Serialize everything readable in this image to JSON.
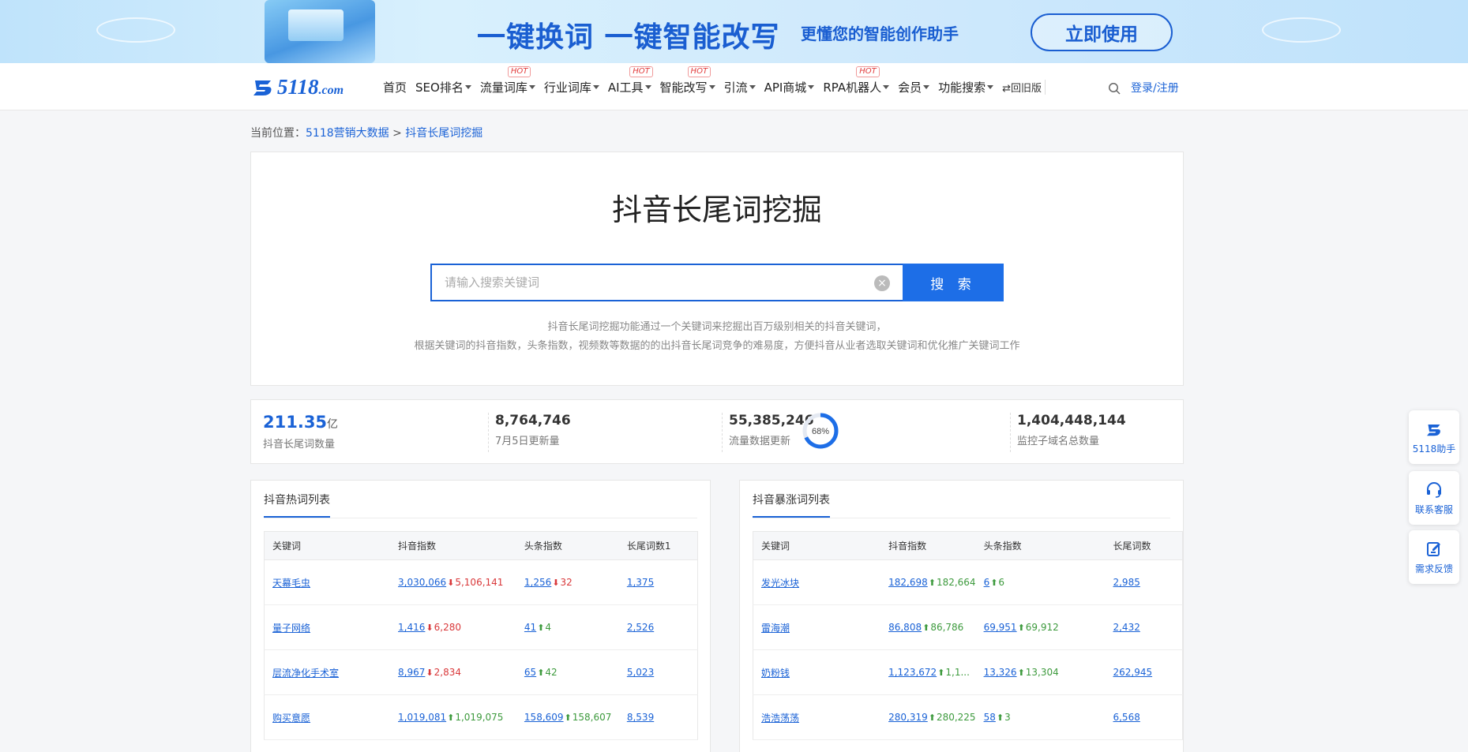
{
  "banner": {
    "slogan": "一键换词 一键智能改写",
    "sub": "更懂您的智能创作助手",
    "cta": "立即使用"
  },
  "nav": {
    "logo_main": "5118",
    "logo_suffix": ".com",
    "items": [
      {
        "label": "首页",
        "caret": false,
        "hot": false
      },
      {
        "label": "SEO排名",
        "caret": true,
        "hot": false
      },
      {
        "label": "流量词库",
        "caret": true,
        "hot": true
      },
      {
        "label": "行业词库",
        "caret": true,
        "hot": false
      },
      {
        "label": "AI工具",
        "caret": true,
        "hot": true
      },
      {
        "label": "智能改写",
        "caret": true,
        "hot": true
      },
      {
        "label": "引流",
        "caret": true,
        "hot": false
      },
      {
        "label": "API商城",
        "caret": true,
        "hot": false
      },
      {
        "label": "RPA机器人",
        "caret": true,
        "hot": true
      },
      {
        "label": "会员",
        "caret": true,
        "hot": false
      },
      {
        "label": "功能搜索",
        "caret": true,
        "hot": false
      }
    ],
    "hot_label": "HOT",
    "old_version": "⇄回旧版",
    "login": "登录/注册"
  },
  "breadcrumb": {
    "prefix": "当前位置：",
    "home": "5118营销大数据",
    "sep": ">",
    "current": "抖音长尾词挖掘"
  },
  "hero": {
    "title": "抖音长尾词挖掘",
    "placeholder": "请输入搜索关键词",
    "search_button": "搜 索",
    "desc_line1": "抖音长尾词挖掘功能通过一个关键词来挖掘出百万级别相关的抖音关键词，",
    "desc_line2": "根据关键词的抖音指数，头条指数，视频数等数据的的出抖音长尾词竞争的难易度，方便抖音从业者选取关键词和优化推广关键词工作"
  },
  "stats": [
    {
      "value": "211.35",
      "unit": "亿",
      "label": "抖音长尾词数量"
    },
    {
      "value": "8,764,746",
      "unit": "",
      "label": "7月5日更新量"
    },
    {
      "value": "55,385,246",
      "unit": "",
      "label": "流量数据更新"
    },
    {
      "value": "1,404,448,144",
      "unit": "",
      "label": "监控子域名总数量"
    }
  ],
  "progress": {
    "percent": 68,
    "label": "68%"
  },
  "hot_list": {
    "title": "抖音热词列表",
    "headers": [
      "关键词",
      "抖音指数",
      "头条指数",
      "长尾词数1"
    ],
    "rows": [
      {
        "kw": "天幕毛虫",
        "dy": "3,030,066",
        "dy_dir": "down",
        "dy_delta": "5,106,141",
        "tt": "1,256",
        "tt_dir": "down",
        "tt_delta": "32",
        "lt": "1,375"
      },
      {
        "kw": "量子网络",
        "dy": "1,416",
        "dy_dir": "down",
        "dy_delta": "6,280",
        "tt": "41",
        "tt_dir": "up",
        "tt_delta": "4",
        "lt": "2,526"
      },
      {
        "kw": "层流净化手术室",
        "dy": "8,967",
        "dy_dir": "down",
        "dy_delta": "2,834",
        "tt": "65",
        "tt_dir": "up",
        "tt_delta": "42",
        "lt": "5,023"
      },
      {
        "kw": "购买意愿",
        "dy": "1,019,081",
        "dy_dir": "up",
        "dy_delta": "1,019,075",
        "tt": "158,609",
        "tt_dir": "up",
        "tt_delta": "158,607",
        "lt": "8,539"
      }
    ]
  },
  "surge_list": {
    "title": "抖音暴涨词列表",
    "headers": [
      "关键词",
      "抖音指数",
      "头条指数",
      "长尾词数"
    ],
    "rows": [
      {
        "kw": "发光冰块",
        "dy": "182,698",
        "dy_dir": "up",
        "dy_delta": "182,664",
        "tt": "6",
        "tt_dir": "up",
        "tt_delta": "6",
        "lt": "2,985"
      },
      {
        "kw": "雷海潮",
        "dy": "86,808",
        "dy_dir": "up",
        "dy_delta": "86,786",
        "tt": "69,951",
        "tt_dir": "up",
        "tt_delta": "69,912",
        "lt": "2,432"
      },
      {
        "kw": "奶粉钱",
        "dy": "1,123,672",
        "dy_dir": "up",
        "dy_delta": "1,1...",
        "tt": "13,326",
        "tt_dir": "up",
        "tt_delta": "13,304",
        "lt": "262,945"
      },
      {
        "kw": "浩浩荡荡",
        "dy": "280,319",
        "dy_dir": "up",
        "dy_delta": "280,225",
        "tt": "58",
        "tt_dir": "up",
        "tt_delta": "3",
        "lt": "6,568"
      }
    ]
  },
  "float": {
    "assistant": "5118助手",
    "service": "联系客服",
    "feedback": "需求反馈"
  },
  "colors": {
    "brand": "#1a62d6",
    "up": "#3d9a3d",
    "down": "#d9383a"
  }
}
